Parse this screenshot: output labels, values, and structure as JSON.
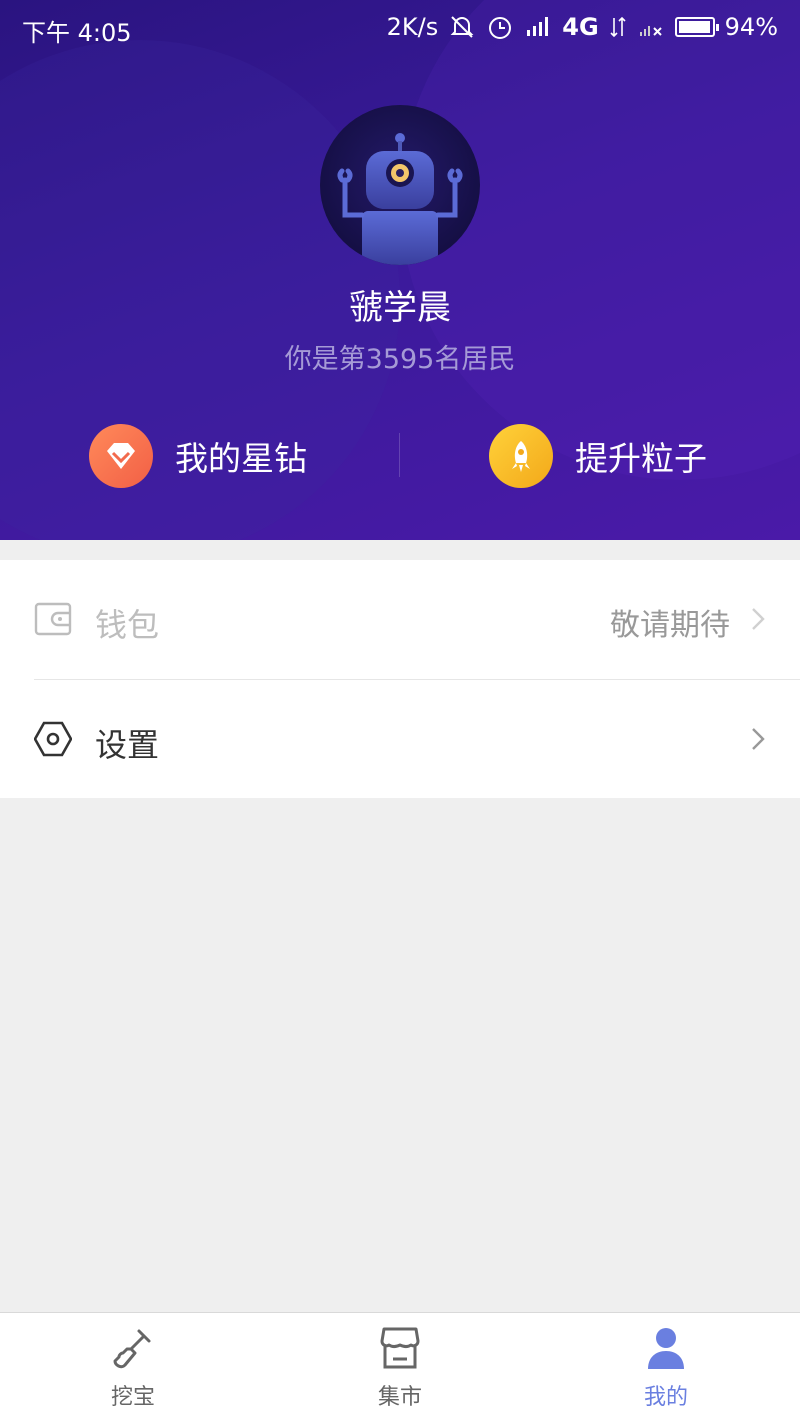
{
  "status_bar": {
    "time": "下午 4:05",
    "speed": "2K/s",
    "network": "4G",
    "battery": "94%",
    "battery_level": 0.94,
    "icons": [
      "mute-bell-icon",
      "alarm-icon",
      "signal-icon",
      "data-arrows-icon",
      "no-signal-icon",
      "battery-icon"
    ]
  },
  "profile": {
    "avatar_icon": "robot-avatar",
    "name": "虢学晨",
    "resident_text": "你是第3595名居民"
  },
  "actions": [
    {
      "label": "我的星钻",
      "icon": "diamond-icon",
      "color": "#f26a4d"
    },
    {
      "label": "提升粒子",
      "icon": "rocket-icon",
      "color": "#f6b726"
    }
  ],
  "menu": [
    {
      "label": "钱包",
      "value": "敬请期待",
      "icon": "wallet-icon",
      "disabled": true
    },
    {
      "label": "设置",
      "value": "",
      "icon": "settings-hexagon-icon",
      "disabled": false
    }
  ],
  "tabbar": {
    "tabs": [
      {
        "label": "挖宝",
        "icon": "shovel-icon",
        "active": false
      },
      {
        "label": "集市",
        "icon": "store-icon",
        "active": false
      },
      {
        "label": "我的",
        "icon": "user-icon",
        "active": true
      }
    ],
    "active_color": "#6a7fe0"
  },
  "colors": {
    "header_gradient": [
      "#2a1480",
      "#4a1aa8"
    ],
    "background": "#efefef"
  }
}
